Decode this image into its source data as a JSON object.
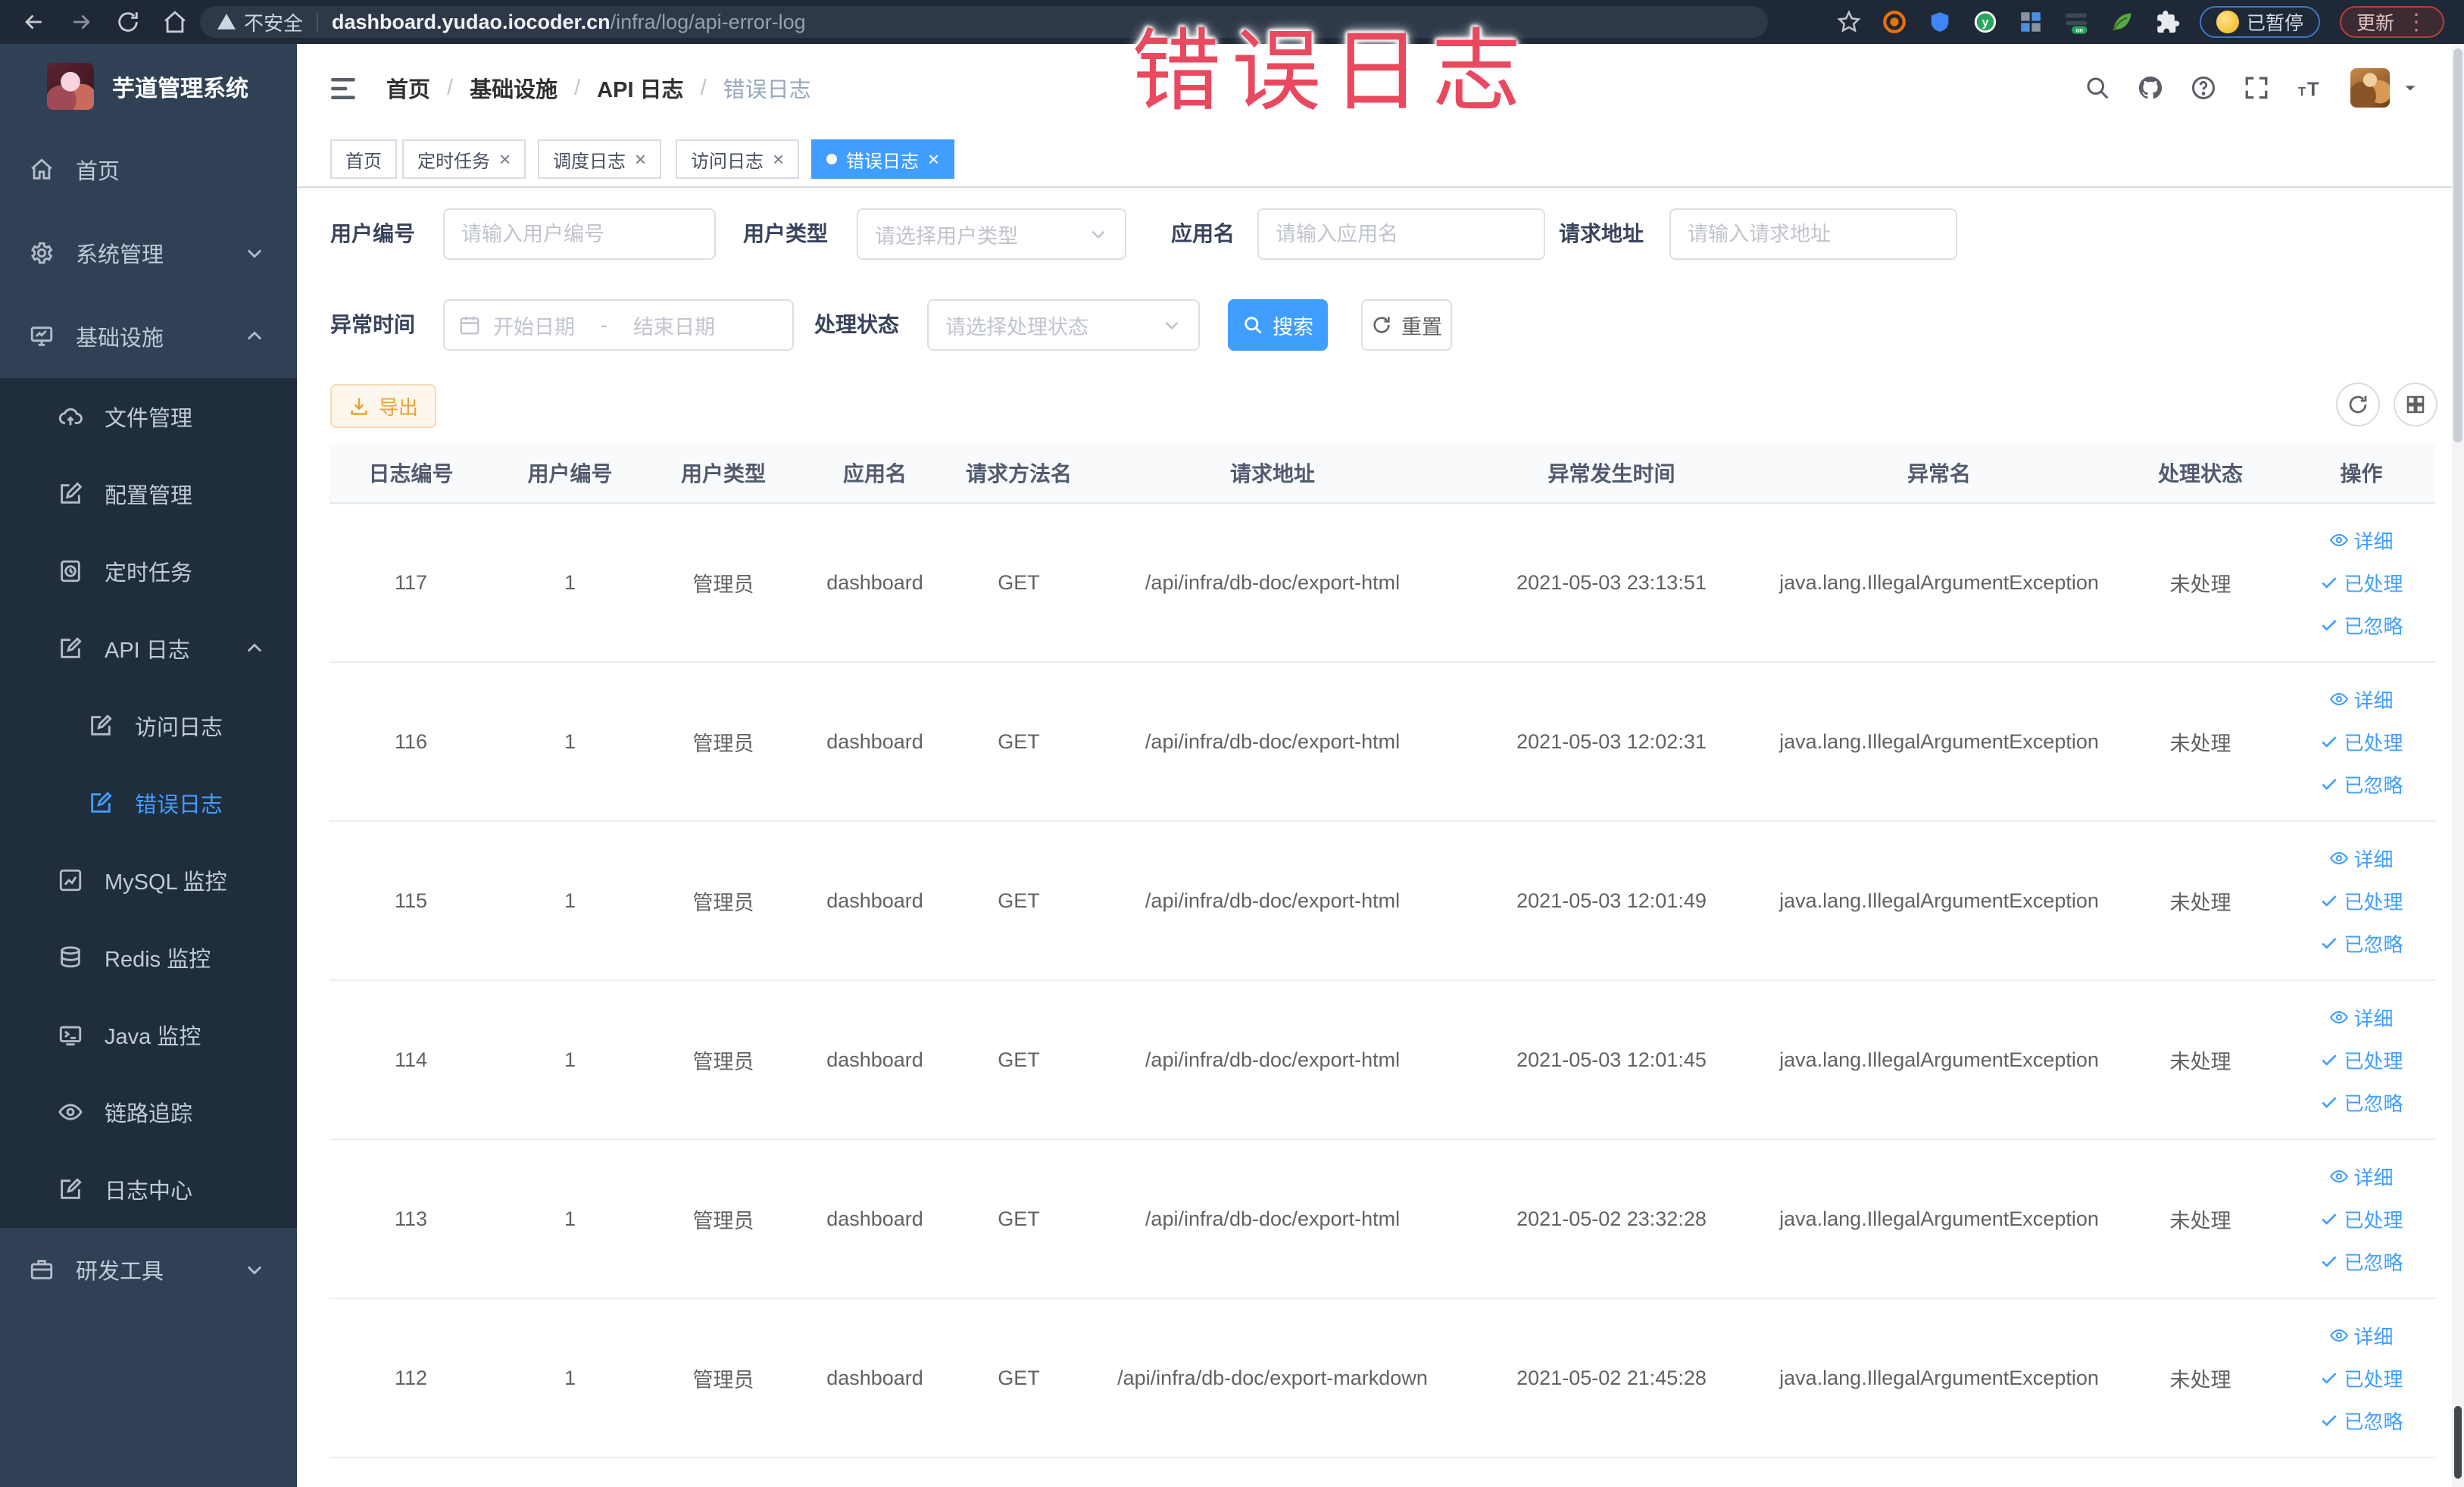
{
  "theme": {
    "accent": "#409EFF",
    "sidebar_bg": "#304156",
    "submenu_bg": "#1f2d3d",
    "warning": "#e6a23c",
    "annotation_color": "#e8495f"
  },
  "annotation": {
    "text": "错误日志"
  },
  "browser": {
    "security_label": "不安全",
    "url_host": "dashboard.yudao.iocoder.cn",
    "url_path": "/infra/log/api-error-log",
    "paused_label": "已暂停",
    "update_label": "更新"
  },
  "sidebar": {
    "title": "芋道管理系统",
    "items": [
      {
        "key": "home",
        "label": "首页",
        "icon": "home",
        "level": 0,
        "chevron": null,
        "active": false
      },
      {
        "key": "system-management",
        "label": "系统管理",
        "icon": "gear",
        "level": 0,
        "chevron": "down",
        "active": false
      },
      {
        "key": "infrastructure",
        "label": "基础设施",
        "icon": "monitor",
        "level": 0,
        "chevron": "up",
        "active": false
      },
      {
        "key": "file-management",
        "label": "文件管理",
        "icon": "cloud-upload",
        "level": 1,
        "chevron": null,
        "active": false
      },
      {
        "key": "config-management",
        "label": "配置管理",
        "icon": "edit",
        "level": 1,
        "chevron": null,
        "active": false
      },
      {
        "key": "scheduled-tasks",
        "label": "定时任务",
        "icon": "clock-doc",
        "level": 1,
        "chevron": null,
        "active": false
      },
      {
        "key": "api-log",
        "label": "API 日志",
        "icon": "doc-edit",
        "level": 1,
        "chevron": "up",
        "active": false
      },
      {
        "key": "access-log",
        "label": "访问日志",
        "icon": "doc-edit",
        "level": 2,
        "chevron": null,
        "active": false
      },
      {
        "key": "error-log",
        "label": "错误日志",
        "icon": "doc-edit",
        "level": 2,
        "chevron": null,
        "active": true
      },
      {
        "key": "mysql-monitor",
        "label": "MySQL 监控",
        "icon": "chart",
        "level": 1,
        "chevron": null,
        "active": false
      },
      {
        "key": "redis-monitor",
        "label": "Redis 监控",
        "icon": "db",
        "level": 1,
        "chevron": null,
        "active": false
      },
      {
        "key": "java-monitor",
        "label": "Java 监控",
        "icon": "java",
        "level": 1,
        "chevron": null,
        "active": false
      },
      {
        "key": "trace",
        "label": "链路追踪",
        "icon": "eye",
        "level": 1,
        "chevron": null,
        "active": false
      },
      {
        "key": "log-center",
        "label": "日志中心",
        "icon": "doc-edit",
        "level": 1,
        "chevron": null,
        "active": false
      },
      {
        "key": "dev-tools",
        "label": "研发工具",
        "icon": "tools",
        "level": 0,
        "chevron": "down",
        "active": false
      }
    ]
  },
  "header": {
    "breadcrumb": [
      "首页",
      "基础设施",
      "API 日志",
      "错误日志"
    ]
  },
  "tabs": [
    {
      "key": "home",
      "label": "首页",
      "closable": false,
      "active": false
    },
    {
      "key": "scheduled-tasks",
      "label": "定时任务",
      "closable": true,
      "active": false
    },
    {
      "key": "schedule-log",
      "label": "调度日志",
      "closable": true,
      "active": false
    },
    {
      "key": "access-log",
      "label": "访问日志",
      "closable": true,
      "active": false
    },
    {
      "key": "error-log",
      "label": "错误日志",
      "closable": true,
      "active": true
    }
  ],
  "filters": {
    "user_id": {
      "label": "用户编号",
      "placeholder": "请输入用户编号"
    },
    "user_type": {
      "label": "用户类型",
      "placeholder": "请选择用户类型"
    },
    "app_name": {
      "label": "应用名",
      "placeholder": "请输入应用名"
    },
    "request_url": {
      "label": "请求地址",
      "placeholder": "请输入请求地址"
    },
    "exception_time": {
      "label": "异常时间",
      "start_placeholder": "开始日期",
      "end_placeholder": "结束日期",
      "separator": "-"
    },
    "process_status": {
      "label": "处理状态",
      "placeholder": "请选择处理状态"
    },
    "search_label": "搜索",
    "reset_label": "重置"
  },
  "toolbar": {
    "export_label": "导出"
  },
  "table": {
    "columns": [
      "日志编号",
      "用户编号",
      "用户类型",
      "应用名",
      "请求方法名",
      "请求地址",
      "异常发生时间",
      "异常名",
      "处理状态",
      "操作"
    ],
    "rows": [
      [
        "117",
        "1",
        "管理员",
        "dashboard",
        "GET",
        "/api/infra/db-doc/export-html",
        "2021-05-03 23:13:51",
        "java.lang.IllegalArgumentException",
        "未处理"
      ],
      [
        "116",
        "1",
        "管理员",
        "dashboard",
        "GET",
        "/api/infra/db-doc/export-html",
        "2021-05-03 12:02:31",
        "java.lang.IllegalArgumentException",
        "未处理"
      ],
      [
        "115",
        "1",
        "管理员",
        "dashboard",
        "GET",
        "/api/infra/db-doc/export-html",
        "2021-05-03 12:01:49",
        "java.lang.IllegalArgumentException",
        "未处理"
      ],
      [
        "114",
        "1",
        "管理员",
        "dashboard",
        "GET",
        "/api/infra/db-doc/export-html",
        "2021-05-03 12:01:45",
        "java.lang.IllegalArgumentException",
        "未处理"
      ],
      [
        "113",
        "1",
        "管理员",
        "dashboard",
        "GET",
        "/api/infra/db-doc/export-html",
        "2021-05-02 23:32:28",
        "java.lang.IllegalArgumentException",
        "未处理"
      ],
      [
        "112",
        "1",
        "管理员",
        "dashboard",
        "GET",
        "/api/infra/db-doc/export-markdown",
        "2021-05-02 21:45:28",
        "java.lang.IllegalArgumentException",
        "未处理"
      ]
    ],
    "actions": {
      "detail": "详细",
      "processed": "已处理",
      "ignored": "已忽略"
    }
  }
}
